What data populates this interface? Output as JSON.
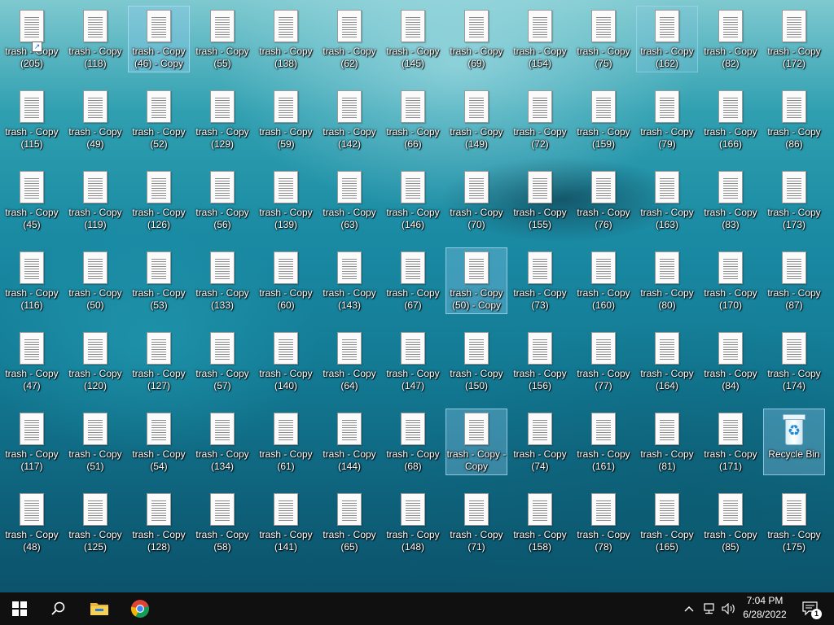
{
  "desktop": {
    "rows": [
      [
        "trash - Copy\n(205)",
        "trash - Copy\n(118)",
        "trash - Copy\n(46) - Copy",
        "trash - Copy\n(55)",
        "trash - Copy\n(138)",
        "trash - Copy\n(62)",
        "trash - Copy\n(145)",
        "trash - Copy\n(69)",
        "trash - Copy\n(154)",
        "trash - Copy\n(75)",
        "trash - Copy\n(162)",
        "trash - Copy\n(82)",
        "trash - Copy\n(172)"
      ],
      [
        "trash - Copy\n(115)",
        "trash - Copy\n(49)",
        "trash - Copy\n(52)",
        "trash - Copy\n(129)",
        "trash - Copy\n(59)",
        "trash - Copy\n(142)",
        "trash - Copy\n(66)",
        "trash - Copy\n(149)",
        "trash - Copy\n(72)",
        "trash - Copy\n(159)",
        "trash - Copy\n(79)",
        "trash - Copy\n(166)",
        "trash - Copy\n(86)"
      ],
      [
        "trash - Copy\n(45)",
        "trash - Copy\n(119)",
        "trash - Copy\n(126)",
        "trash - Copy\n(56)",
        "trash - Copy\n(139)",
        "trash - Copy\n(63)",
        "trash - Copy\n(146)",
        "trash - Copy\n(70)",
        "trash - Copy\n(155)",
        "trash - Copy\n(76)",
        "trash - Copy\n(163)",
        "trash - Copy\n(83)",
        "trash - Copy\n(173)"
      ],
      [
        "trash - Copy\n(116)",
        "trash - Copy\n(50)",
        "trash - Copy\n(53)",
        "trash - Copy\n(133)",
        "trash - Copy\n(60)",
        "trash - Copy\n(143)",
        "trash - Copy\n(67)",
        "trash - Copy\n(50) - Copy",
        "trash - Copy\n(73)",
        "trash - Copy\n(160)",
        "trash - Copy\n(80)",
        "trash - Copy\n(170)",
        "trash - Copy\n(87)"
      ],
      [
        "trash - Copy\n(47)",
        "trash - Copy\n(120)",
        "trash - Copy\n(127)",
        "trash - Copy\n(57)",
        "trash - Copy\n(140)",
        "trash - Copy\n(64)",
        "trash - Copy\n(147)",
        "trash - Copy\n(150)",
        "trash - Copy\n(156)",
        "trash - Copy\n(77)",
        "trash - Copy\n(164)",
        "trash - Copy\n(84)",
        "trash - Copy\n(174)"
      ],
      [
        "trash - Copy\n(117)",
        "trash - Copy\n(51)",
        "trash - Copy\n(54)",
        "trash - Copy\n(134)",
        "trash - Copy\n(61)",
        "trash - Copy\n(144)",
        "trash - Copy\n(68)",
        "trash - Copy -\nCopy",
        "trash - Copy\n(74)",
        "trash - Copy\n(161)",
        "trash - Copy\n(81)",
        "trash - Copy\n(171)",
        "Recycle Bin"
      ],
      [
        "trash - Copy\n(48)",
        "trash - Copy\n(125)",
        "trash - Copy\n(128)",
        "trash - Copy\n(58)",
        "trash - Copy\n(141)",
        "trash - Copy\n(65)",
        "trash - Copy\n(148)",
        "trash - Copy\n(71)",
        "trash - Copy\n(158)",
        "trash - Copy\n(78)",
        "trash - Copy\n(165)",
        "trash - Copy\n(85)",
        "trash - Copy\n(175)"
      ]
    ],
    "selected": [
      [
        0,
        2
      ],
      [
        3,
        7
      ],
      [
        5,
        7
      ],
      [
        5,
        12
      ]
    ],
    "hovered": [
      [
        0,
        10
      ]
    ],
    "recycle_bin_label": "Recycle Bin"
  },
  "taskbar": {
    "start_icon": "windows-start-icon",
    "search_icon": "search-icon",
    "apps": [
      {
        "name": "file-explorer-icon"
      },
      {
        "name": "chrome-icon"
      }
    ],
    "tray": {
      "chevron_icon": "chevron-up-icon",
      "network_icon": "network-icon",
      "volume_icon": "volume-icon",
      "time": "7:04 PM",
      "date": "6/28/2022",
      "notification_icon": "notification-icon",
      "notification_count": "1"
    }
  },
  "colors": {
    "taskbar": "#101010",
    "selection": "#8cc8eb"
  }
}
